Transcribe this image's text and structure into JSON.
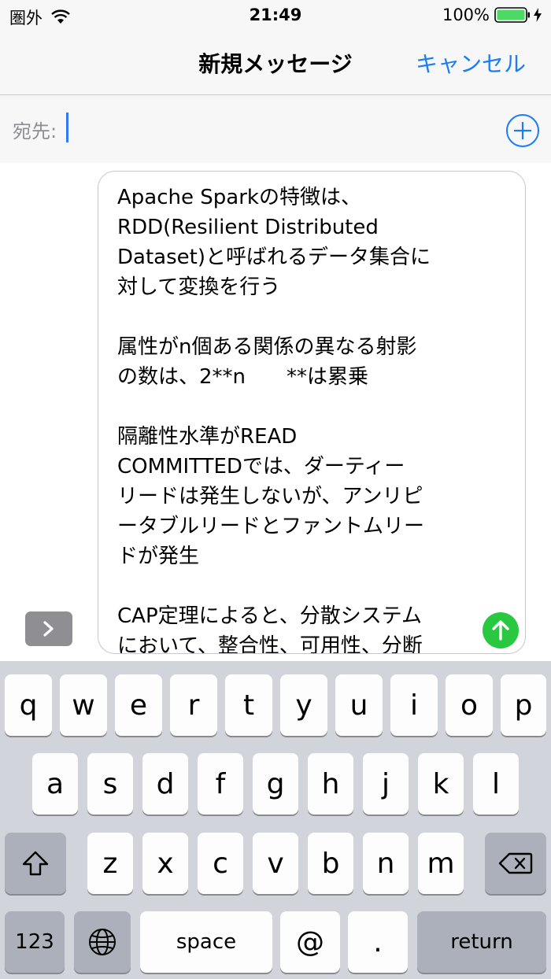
{
  "status_bar": {
    "carrier": "圏外",
    "time": "21:49",
    "battery_percent": "100%",
    "battery_level": 1.0
  },
  "nav": {
    "title": "新規メッセージ",
    "cancel_label": "キャンセル"
  },
  "to_field": {
    "label": "宛先:",
    "value": ""
  },
  "compose": {
    "text": "Apache Sparkの特徴は、\nRDD(Resilient Distributed\nDataset)と呼ばれるデータ集合に\n対して変換を行う\n\n属性がn個ある関係の異なる射影\nの数は、2**n　　**は累乗\n\n隔離性水準がREAD\nCOMMITTEDでは、ダーティー\nリードは発生しないが、アンリピ\nータブルリードとファントムリー\nドが発生\n\nCAP定理によると、分散システム\nにおいて、整合性、可用性、分断"
  },
  "keyboard": {
    "row1": [
      "q",
      "w",
      "e",
      "r",
      "t",
      "y",
      "u",
      "i",
      "o",
      "p"
    ],
    "row2": [
      "a",
      "s",
      "d",
      "f",
      "g",
      "h",
      "j",
      "k",
      "l"
    ],
    "row3": [
      "z",
      "x",
      "c",
      "v",
      "b",
      "n",
      "m"
    ],
    "numbers_label": "123",
    "space_label": "space",
    "at_label": "@",
    "period_label": ".",
    "return_label": "return"
  },
  "colors": {
    "accent": "#1a7cf6",
    "send": "#28c840",
    "battery": "#4cd964",
    "keyboard_bg": "#d1d5db"
  },
  "icons": {
    "wifi": "wifi-icon",
    "battery": "battery-icon",
    "charging": "charging-bolt-icon",
    "add": "plus-circle-icon",
    "expand": "chevron-right-icon",
    "send": "arrow-up-icon",
    "shift": "shift-arrow-icon",
    "delete": "backspace-icon",
    "globe": "globe-icon"
  }
}
